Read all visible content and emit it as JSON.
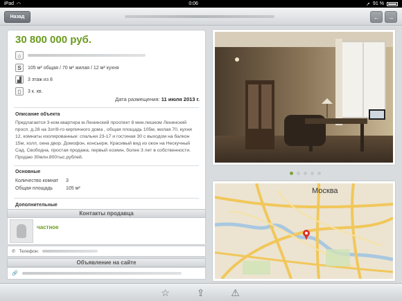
{
  "status": {
    "carrier": "iPad",
    "time": "0:06",
    "battery": "91 %"
  },
  "nav": {
    "back_label": "Назад",
    "prev_icon": "arrow-left-icon",
    "next_icon": "arrow-right-icon"
  },
  "listing": {
    "price": "30 800 000  руб.",
    "area": "105 м² общая / 70 м² жилая / 12 м² кухня",
    "floor": "3 этаж из 8",
    "rooms": "3 к. кв.",
    "date_label": "Дата размещения:",
    "date_value": "11 июля 2013 г.",
    "description_title": "Описание объекта",
    "description": "Предлагается 3-ком.квартира м.Ленинский проспект 8 мин.пешком Ленинский просп. д.28 на  3эт/8-го  кирпичного дома , общая площадь 105м, жилая 70, кухня 12, комнаты изолированные: спальни 23-17 и гостиная 30 с выходом на балкон 15м, холл, окна двор. Домофон, консьерж. Красивый вид из окон на Нескучный Сад. Свободна, простая продажа, первый хозяин, более 3 лет в собственности. Продаю 30млн.800тыс.рублей.",
    "basics_title": "Основные",
    "rooms_label": "Количество комнат",
    "rooms_value": "3",
    "total_area_label": "Общая площадь",
    "total_area_value": "105 м²",
    "extra_title": "Дополнительные"
  },
  "seller": {
    "section_title": "Контакты продавца",
    "type": "частное",
    "phone_label": "Телефон:"
  },
  "site": {
    "section_title": "Объявление на сайте"
  },
  "map": {
    "city": "Москва"
  },
  "gallery": {
    "total": 5,
    "active": 1
  },
  "toolbar": {
    "favorite_icon": "star-icon",
    "share_icon": "share-icon",
    "report_icon": "warning-icon"
  }
}
